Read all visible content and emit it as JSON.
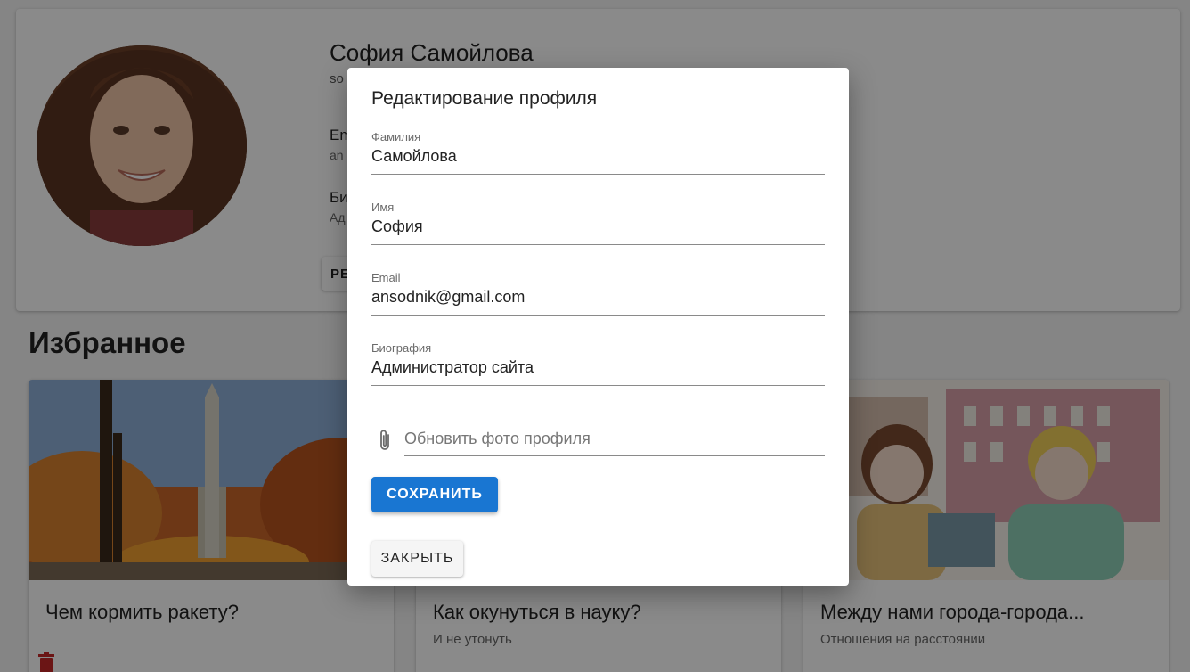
{
  "profile": {
    "name": "София Самойлова",
    "login": "so",
    "email_label": "Em",
    "email_value": "an",
    "bio_label": "Би",
    "bio_value": "Ад",
    "edit_button": "РЕ"
  },
  "favorites": {
    "title": "Избранное",
    "posts": [
      {
        "title": "Чем кормить ракету?",
        "subtitle": "",
        "image": "rocket-launch"
      },
      {
        "title": "Как окунуться в науку?",
        "subtitle": "И не утонуть",
        "image": ""
      },
      {
        "title": "Между нами города-города...",
        "subtitle": "Отношения на расстоянии",
        "image": "watercolor-couple"
      }
    ]
  },
  "dialog": {
    "title": "Редактирование профиля",
    "fields": [
      {
        "label": "Фамилия",
        "value": "Самойлова"
      },
      {
        "label": "Имя",
        "value": "София"
      },
      {
        "label": "Email",
        "value": "ansodnik@gmail.com"
      },
      {
        "label": "Биография",
        "value": "Администратор сайта"
      }
    ],
    "photo_placeholder": "Обновить фото профиля",
    "save_label": "СОХРАНИТЬ",
    "close_label": "ЗАКРЫТЬ"
  },
  "colors": {
    "primary": "#1976d2",
    "delete": "#c62828",
    "overlay": "rgba(0,0,0,0.46)"
  },
  "icons": {
    "attach": "paperclip-icon",
    "delete": "trash-icon"
  }
}
